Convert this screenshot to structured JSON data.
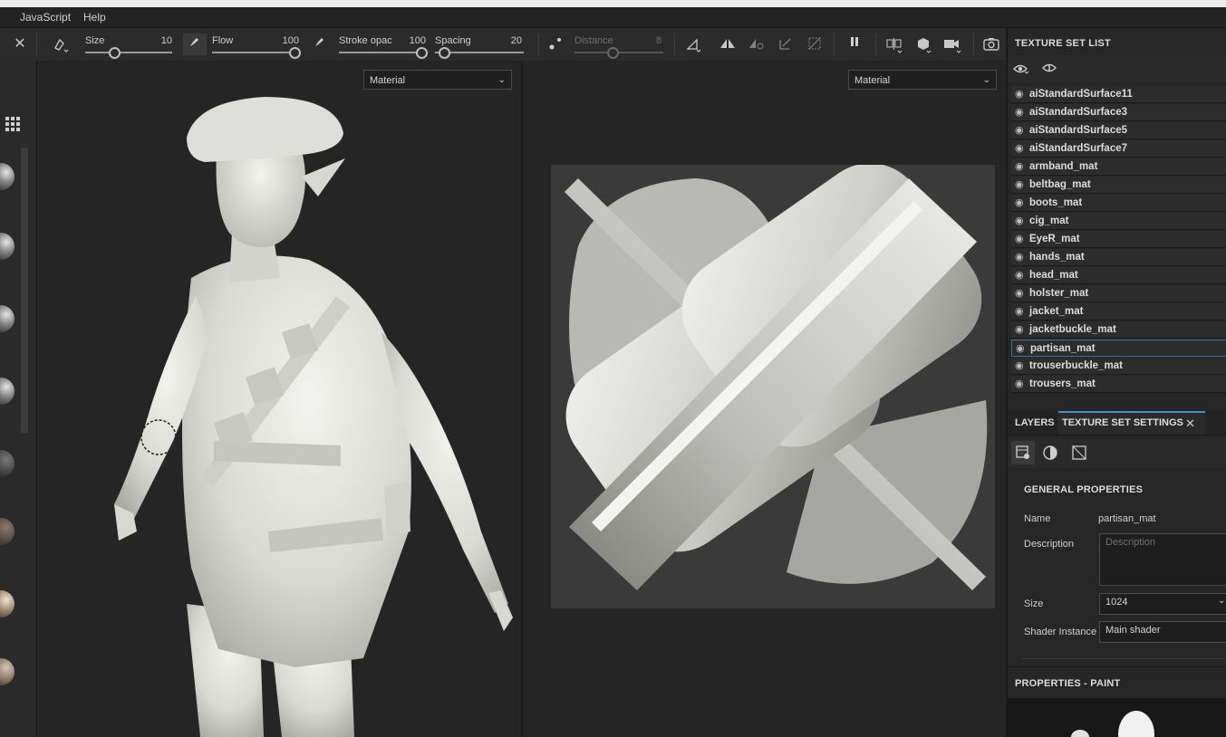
{
  "menubar": {
    "items": [
      "JavaScript",
      "Help"
    ]
  },
  "toolbar": {
    "size": {
      "label": "Size",
      "value": "10"
    },
    "flow": {
      "label": "Flow",
      "value": "100"
    },
    "stroke_opacity": {
      "label": "Stroke opac",
      "value": "100"
    },
    "spacing": {
      "label": "Spacing",
      "value": "20"
    },
    "distance": {
      "label": "Distance",
      "value": "8"
    }
  },
  "viewport_3d": {
    "mode": "Material"
  },
  "viewport_2d": {
    "mode": "Material"
  },
  "texture_set_list": {
    "title": "TEXTURE SET LIST",
    "items": [
      {
        "name": "aiStandardSurface11",
        "selected": false
      },
      {
        "name": "aiStandardSurface3",
        "selected": false
      },
      {
        "name": "aiStandardSurface5",
        "selected": false
      },
      {
        "name": "aiStandardSurface7",
        "selected": false
      },
      {
        "name": "armband_mat",
        "selected": false
      },
      {
        "name": "beltbag_mat",
        "selected": false
      },
      {
        "name": "boots_mat",
        "selected": false
      },
      {
        "name": "cig_mat",
        "selected": false
      },
      {
        "name": "EyeR_mat",
        "selected": false
      },
      {
        "name": "hands_mat",
        "selected": false
      },
      {
        "name": "head_mat",
        "selected": false
      },
      {
        "name": "holster_mat",
        "selected": false
      },
      {
        "name": "jacket_mat",
        "selected": false
      },
      {
        "name": "jacketbuckle_mat",
        "selected": false
      },
      {
        "name": "partisan_mat",
        "selected": true
      },
      {
        "name": "trouserbuckle_mat",
        "selected": false
      },
      {
        "name": "trousers_mat",
        "selected": false
      }
    ]
  },
  "tabs": {
    "layers": "LAYERS",
    "texture_set_settings": "TEXTURE SET SETTINGS"
  },
  "general_properties": {
    "title": "GENERAL PROPERTIES",
    "name_label": "Name",
    "name_value": "partisan_mat",
    "description_label": "Description",
    "description_placeholder": "Description",
    "size_label": "Size",
    "size_value": "1024",
    "shader_label": "Shader Instance",
    "shader_value": "Main shader"
  },
  "properties_paint": {
    "title": "PROPERTIES - PAINT"
  },
  "colors": {
    "accent": "#4a8fd6",
    "selected_border": "#4a6a9c"
  }
}
